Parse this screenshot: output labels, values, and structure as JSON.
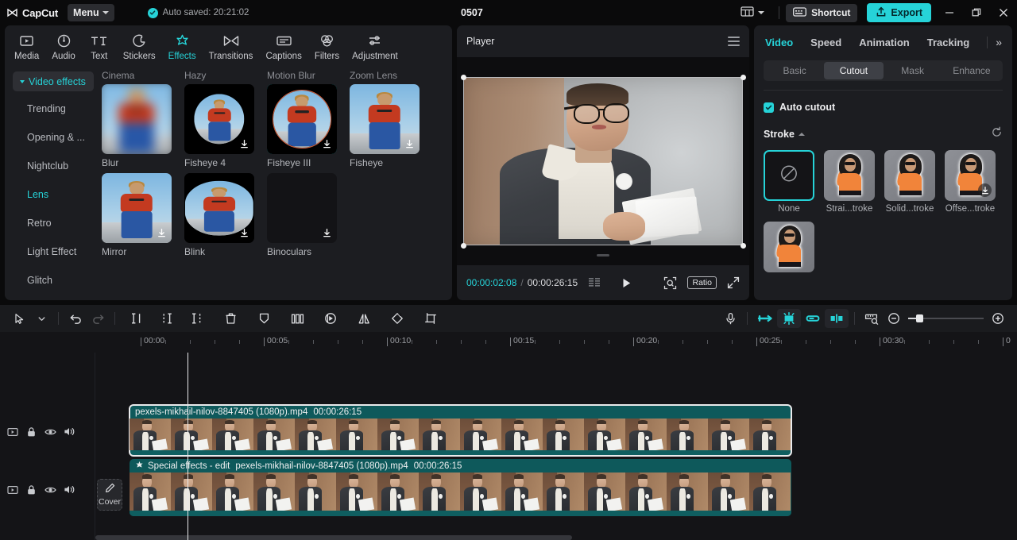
{
  "titlebar": {
    "app_name": "CapCut",
    "menu_label": "Menu",
    "autosave_text": "Auto saved: 20:21:02",
    "project_title": "0507",
    "shortcut_label": "Shortcut",
    "export_label": "Export",
    "accent_color": "#26d3d8"
  },
  "library": {
    "main_tabs": [
      {
        "label": "Media",
        "icon": "media-icon",
        "active": false
      },
      {
        "label": "Audio",
        "icon": "audio-icon",
        "active": false
      },
      {
        "label": "Text",
        "icon": "text-icon",
        "active": false
      },
      {
        "label": "Stickers",
        "icon": "stickers-icon",
        "active": false
      },
      {
        "label": "Effects",
        "icon": "effects-icon",
        "active": true
      },
      {
        "label": "Transitions",
        "icon": "transitions-icon",
        "active": false
      },
      {
        "label": "Captions",
        "icon": "captions-icon",
        "active": false
      },
      {
        "label": "Filters",
        "icon": "filters-icon",
        "active": false
      },
      {
        "label": "Adjustment",
        "icon": "adjustment-icon",
        "active": false
      }
    ],
    "nav_header": "Video effects",
    "nav_items": [
      {
        "label": "Trending",
        "active": false
      },
      {
        "label": "Opening & ...",
        "active": false
      },
      {
        "label": "Nightclub",
        "active": false
      },
      {
        "label": "Lens",
        "active": true
      },
      {
        "label": "Retro",
        "active": false
      },
      {
        "label": "Light Effect",
        "active": false
      },
      {
        "label": "Glitch",
        "active": false
      }
    ],
    "category_labels": [
      "Cinema",
      "Hazy",
      "Motion Blur",
      "Zoom Lens"
    ],
    "effects": [
      {
        "label": "Blur",
        "style": "blur",
        "download": false,
        "selected": false
      },
      {
        "label": "Fisheye 4",
        "style": "fisheye",
        "download": true,
        "selected": false
      },
      {
        "label": "Fisheye III",
        "style": "fisheye-ring",
        "download": true,
        "selected": true
      },
      {
        "label": "Fisheye",
        "style": "plain",
        "download": true,
        "selected": false
      },
      {
        "label": "Mirror",
        "style": "plain",
        "download": true,
        "selected": false
      },
      {
        "label": "Blink",
        "style": "blink",
        "download": true,
        "selected": false
      },
      {
        "label": "Binoculars",
        "style": "black",
        "download": true,
        "selected": false
      }
    ]
  },
  "player": {
    "title": "Player",
    "current_time": "00:00:02:08",
    "separator": "/",
    "total_time": "00:00:26:15",
    "ratio_label": "Ratio"
  },
  "inspector": {
    "tabs": [
      {
        "label": "Video",
        "active": true
      },
      {
        "label": "Speed",
        "active": false
      },
      {
        "label": "Animation",
        "active": false
      },
      {
        "label": "Tracking",
        "active": false
      }
    ],
    "more_glyph": "»",
    "subtabs": [
      {
        "label": "Basic",
        "active": false
      },
      {
        "label": "Cutout",
        "active": true
      },
      {
        "label": "Mask",
        "active": false
      },
      {
        "label": "Enhance",
        "active": false
      }
    ],
    "auto_cutout_label": "Auto cutout",
    "auto_cutout_checked": true,
    "stroke_label": "Stroke",
    "strokes": [
      {
        "label": "None",
        "kind": "none",
        "selected": true,
        "download": false
      },
      {
        "label": "Strai...troke",
        "kind": "photo",
        "selected": false,
        "download": false
      },
      {
        "label": "Solid...troke",
        "kind": "photo",
        "selected": false,
        "download": false
      },
      {
        "label": "Offse...troke",
        "kind": "photo",
        "selected": false,
        "download": true
      },
      {
        "label": "",
        "kind": "photo",
        "selected": false,
        "download": false
      }
    ]
  },
  "timeline": {
    "toolbar_left": [
      "select-icon",
      "chevron-down-icon",
      "undo-icon",
      "redo-icon",
      "split-left-icon",
      "split-icon",
      "split-right-icon",
      "delete-icon",
      "freeze-icon",
      "crop-frame-icon",
      "reverse-icon",
      "mirror-icon",
      "rotate-icon",
      "crop-icon"
    ],
    "toolbar_right": [
      "mic-icon",
      "snap-left-icon",
      "auto-snap-icon",
      "link-icon",
      "align-icon",
      "timeline-zoom-icon",
      "zoom-out-icon",
      "zoom-slider",
      "zoom-in-icon"
    ],
    "ruler_labels": [
      "00:00",
      "00:05",
      "00:10",
      "00:15",
      "00:20",
      "00:25",
      "00:30",
      "0"
    ],
    "cover_label": "Cover",
    "track_controls": [
      "video-track-icon",
      "lock-icon",
      "eye-icon",
      "volume-icon"
    ],
    "clips": [
      {
        "track": 1,
        "name": "pexels-mikhail-nilov-8847405 (1080p).mp4",
        "duration": "00:00:26:15",
        "selected": true,
        "effect_tag": ""
      },
      {
        "track": 2,
        "name": "pexels-mikhail-nilov-8847405 (1080p).mp4",
        "duration": "00:00:26:15",
        "selected": false,
        "effect_tag": "Special effects - edit"
      }
    ]
  }
}
